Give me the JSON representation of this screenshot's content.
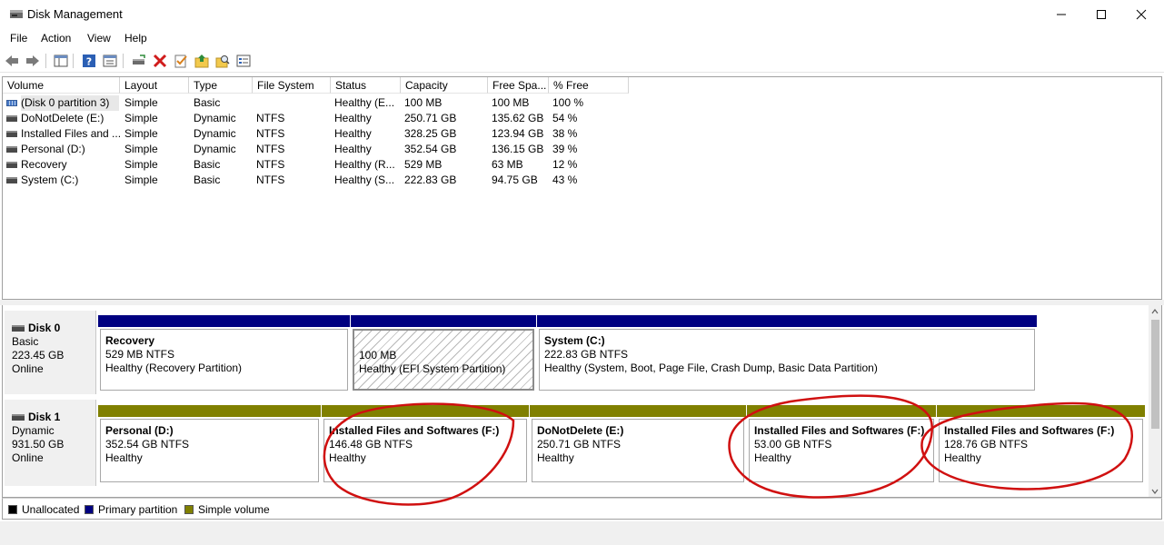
{
  "window": {
    "title": "Disk Management"
  },
  "menu": [
    "File",
    "Action",
    "View",
    "Help"
  ],
  "columns": [
    "Volume",
    "Layout",
    "Type",
    "File System",
    "Status",
    "Capacity",
    "Free Spa...",
    "% Free"
  ],
  "volumes": [
    {
      "volume": "(Disk 0 partition 3)",
      "layout": "Simple",
      "type": "Basic",
      "fs": "",
      "status": "Healthy (E...",
      "capacity": "100 MB",
      "free": "100 MB",
      "pct": "100 %",
      "icon": "striped-volume-icon"
    },
    {
      "volume": "DoNotDelete (E:)",
      "layout": "Simple",
      "type": "Dynamic",
      "fs": "NTFS",
      "status": "Healthy",
      "capacity": "250.71 GB",
      "free": "135.62 GB",
      "pct": "54 %",
      "icon": "volume-icon"
    },
    {
      "volume": "Installed Files and ...",
      "layout": "Simple",
      "type": "Dynamic",
      "fs": "NTFS",
      "status": "Healthy",
      "capacity": "328.25 GB",
      "free": "123.94 GB",
      "pct": "38 %",
      "icon": "volume-icon"
    },
    {
      "volume": "Personal (D:)",
      "layout": "Simple",
      "type": "Dynamic",
      "fs": "NTFS",
      "status": "Healthy",
      "capacity": "352.54 GB",
      "free": "136.15 GB",
      "pct": "39 %",
      "icon": "volume-icon"
    },
    {
      "volume": "Recovery",
      "layout": "Simple",
      "type": "Basic",
      "fs": "NTFS",
      "status": "Healthy (R...",
      "capacity": "529 MB",
      "free": "63 MB",
      "pct": "12 %",
      "icon": "volume-icon"
    },
    {
      "volume": "System (C:)",
      "layout": "Simple",
      "type": "Basic",
      "fs": "NTFS",
      "status": "Healthy (S...",
      "capacity": "222.83 GB",
      "free": "94.75 GB",
      "pct": "43 %",
      "icon": "volume-icon"
    }
  ],
  "disks": [
    {
      "name": "Disk 0",
      "kind": "Basic",
      "size": "223.45 GB",
      "state": "Online",
      "partitions": [
        {
          "name": "Recovery",
          "size": "529 MB NTFS",
          "status": "Healthy (Recovery Partition)",
          "bar": "#000080"
        },
        {
          "name": "",
          "size": "100 MB",
          "status": "Healthy (EFI System Partition)",
          "bar": "#000080"
        },
        {
          "name": "System  (C:)",
          "size": "222.83 GB NTFS",
          "status": "Healthy (System, Boot, Page File, Crash Dump, Basic Data Partition)",
          "bar": "#000080"
        }
      ]
    },
    {
      "name": "Disk 1",
      "kind": "Dynamic",
      "size": "931.50 GB",
      "state": "Online",
      "partitions": [
        {
          "name": "Personal  (D:)",
          "size": "352.54 GB NTFS",
          "status": "Healthy",
          "bar": "#808000"
        },
        {
          "name": "Installed Files and Softwares  (F:)",
          "size": "146.48 GB NTFS",
          "status": "Healthy",
          "bar": "#808000"
        },
        {
          "name": "DoNotDelete  (E:)",
          "size": "250.71 GB NTFS",
          "status": "Healthy",
          "bar": "#808000"
        },
        {
          "name": "Installed Files and Softwares  (F:)",
          "size": "53.00 GB NTFS",
          "status": "Healthy",
          "bar": "#808000"
        },
        {
          "name": "Installed Files and Softwares  (F:)",
          "size": "128.76 GB NTFS",
          "status": "Healthy",
          "bar": "#808000"
        }
      ]
    }
  ],
  "legend": [
    {
      "label": "Unallocated",
      "color": "#000000"
    },
    {
      "label": "Primary partition",
      "color": "#000080"
    },
    {
      "label": "Simple volume",
      "color": "#808000"
    }
  ],
  "colors": {
    "annotation": "#d01010"
  }
}
